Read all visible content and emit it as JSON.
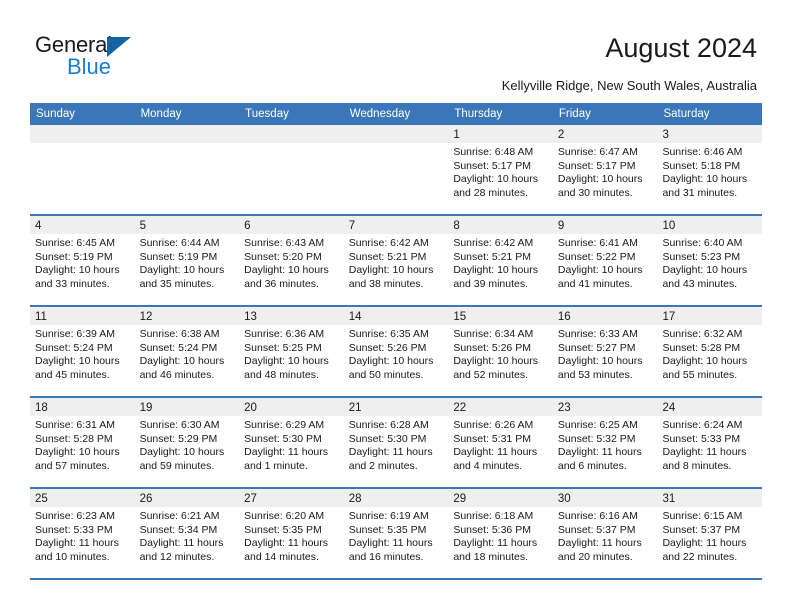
{
  "brand": {
    "word1": "General",
    "word2": "Blue",
    "triangle_color": "#1464a5",
    "blue_color": "#1a7fd4"
  },
  "header": {
    "title": "August 2024",
    "subtitle": "Kellyville Ridge, New South Wales, Australia"
  },
  "theme": {
    "header_blue": "#3a76b8",
    "day_band_gray": "#efefef",
    "text": "#1a1a1a"
  },
  "weekdays": [
    "Sunday",
    "Monday",
    "Tuesday",
    "Wednesday",
    "Thursday",
    "Friday",
    "Saturday"
  ],
  "weeks": [
    [
      {
        "day": "",
        "empty": true,
        "l1": "",
        "l2": "",
        "l3": "",
        "l4": ""
      },
      {
        "day": "",
        "empty": true,
        "l1": "",
        "l2": "",
        "l3": "",
        "l4": ""
      },
      {
        "day": "",
        "empty": true,
        "l1": "",
        "l2": "",
        "l3": "",
        "l4": ""
      },
      {
        "day": "",
        "empty": true,
        "l1": "",
        "l2": "",
        "l3": "",
        "l4": ""
      },
      {
        "day": "1",
        "empty": false,
        "l1": "Sunrise: 6:48 AM",
        "l2": "Sunset: 5:17 PM",
        "l3": "Daylight: 10 hours",
        "l4": "and 28 minutes."
      },
      {
        "day": "2",
        "empty": false,
        "l1": "Sunrise: 6:47 AM",
        "l2": "Sunset: 5:17 PM",
        "l3": "Daylight: 10 hours",
        "l4": "and 30 minutes."
      },
      {
        "day": "3",
        "empty": false,
        "l1": "Sunrise: 6:46 AM",
        "l2": "Sunset: 5:18 PM",
        "l3": "Daylight: 10 hours",
        "l4": "and 31 minutes."
      }
    ],
    [
      {
        "day": "4",
        "empty": false,
        "l1": "Sunrise: 6:45 AM",
        "l2": "Sunset: 5:19 PM",
        "l3": "Daylight: 10 hours",
        "l4": "and 33 minutes."
      },
      {
        "day": "5",
        "empty": false,
        "l1": "Sunrise: 6:44 AM",
        "l2": "Sunset: 5:19 PM",
        "l3": "Daylight: 10 hours",
        "l4": "and 35 minutes."
      },
      {
        "day": "6",
        "empty": false,
        "l1": "Sunrise: 6:43 AM",
        "l2": "Sunset: 5:20 PM",
        "l3": "Daylight: 10 hours",
        "l4": "and 36 minutes."
      },
      {
        "day": "7",
        "empty": false,
        "l1": "Sunrise: 6:42 AM",
        "l2": "Sunset: 5:21 PM",
        "l3": "Daylight: 10 hours",
        "l4": "and 38 minutes."
      },
      {
        "day": "8",
        "empty": false,
        "l1": "Sunrise: 6:42 AM",
        "l2": "Sunset: 5:21 PM",
        "l3": "Daylight: 10 hours",
        "l4": "and 39 minutes."
      },
      {
        "day": "9",
        "empty": false,
        "l1": "Sunrise: 6:41 AM",
        "l2": "Sunset: 5:22 PM",
        "l3": "Daylight: 10 hours",
        "l4": "and 41 minutes."
      },
      {
        "day": "10",
        "empty": false,
        "l1": "Sunrise: 6:40 AM",
        "l2": "Sunset: 5:23 PM",
        "l3": "Daylight: 10 hours",
        "l4": "and 43 minutes."
      }
    ],
    [
      {
        "day": "11",
        "empty": false,
        "l1": "Sunrise: 6:39 AM",
        "l2": "Sunset: 5:24 PM",
        "l3": "Daylight: 10 hours",
        "l4": "and 45 minutes."
      },
      {
        "day": "12",
        "empty": false,
        "l1": "Sunrise: 6:38 AM",
        "l2": "Sunset: 5:24 PM",
        "l3": "Daylight: 10 hours",
        "l4": "and 46 minutes."
      },
      {
        "day": "13",
        "empty": false,
        "l1": "Sunrise: 6:36 AM",
        "l2": "Sunset: 5:25 PM",
        "l3": "Daylight: 10 hours",
        "l4": "and 48 minutes."
      },
      {
        "day": "14",
        "empty": false,
        "l1": "Sunrise: 6:35 AM",
        "l2": "Sunset: 5:26 PM",
        "l3": "Daylight: 10 hours",
        "l4": "and 50 minutes."
      },
      {
        "day": "15",
        "empty": false,
        "l1": "Sunrise: 6:34 AM",
        "l2": "Sunset: 5:26 PM",
        "l3": "Daylight: 10 hours",
        "l4": "and 52 minutes."
      },
      {
        "day": "16",
        "empty": false,
        "l1": "Sunrise: 6:33 AM",
        "l2": "Sunset: 5:27 PM",
        "l3": "Daylight: 10 hours",
        "l4": "and 53 minutes."
      },
      {
        "day": "17",
        "empty": false,
        "l1": "Sunrise: 6:32 AM",
        "l2": "Sunset: 5:28 PM",
        "l3": "Daylight: 10 hours",
        "l4": "and 55 minutes."
      }
    ],
    [
      {
        "day": "18",
        "empty": false,
        "l1": "Sunrise: 6:31 AM",
        "l2": "Sunset: 5:28 PM",
        "l3": "Daylight: 10 hours",
        "l4": "and 57 minutes."
      },
      {
        "day": "19",
        "empty": false,
        "l1": "Sunrise: 6:30 AM",
        "l2": "Sunset: 5:29 PM",
        "l3": "Daylight: 10 hours",
        "l4": "and 59 minutes."
      },
      {
        "day": "20",
        "empty": false,
        "l1": "Sunrise: 6:29 AM",
        "l2": "Sunset: 5:30 PM",
        "l3": "Daylight: 11 hours",
        "l4": "and 1 minute."
      },
      {
        "day": "21",
        "empty": false,
        "l1": "Sunrise: 6:28 AM",
        "l2": "Sunset: 5:30 PM",
        "l3": "Daylight: 11 hours",
        "l4": "and 2 minutes."
      },
      {
        "day": "22",
        "empty": false,
        "l1": "Sunrise: 6:26 AM",
        "l2": "Sunset: 5:31 PM",
        "l3": "Daylight: 11 hours",
        "l4": "and 4 minutes."
      },
      {
        "day": "23",
        "empty": false,
        "l1": "Sunrise: 6:25 AM",
        "l2": "Sunset: 5:32 PM",
        "l3": "Daylight: 11 hours",
        "l4": "and 6 minutes."
      },
      {
        "day": "24",
        "empty": false,
        "l1": "Sunrise: 6:24 AM",
        "l2": "Sunset: 5:33 PM",
        "l3": "Daylight: 11 hours",
        "l4": "and 8 minutes."
      }
    ],
    [
      {
        "day": "25",
        "empty": false,
        "l1": "Sunrise: 6:23 AM",
        "l2": "Sunset: 5:33 PM",
        "l3": "Daylight: 11 hours",
        "l4": "and 10 minutes."
      },
      {
        "day": "26",
        "empty": false,
        "l1": "Sunrise: 6:21 AM",
        "l2": "Sunset: 5:34 PM",
        "l3": "Daylight: 11 hours",
        "l4": "and 12 minutes."
      },
      {
        "day": "27",
        "empty": false,
        "l1": "Sunrise: 6:20 AM",
        "l2": "Sunset: 5:35 PM",
        "l3": "Daylight: 11 hours",
        "l4": "and 14 minutes."
      },
      {
        "day": "28",
        "empty": false,
        "l1": "Sunrise: 6:19 AM",
        "l2": "Sunset: 5:35 PM",
        "l3": "Daylight: 11 hours",
        "l4": "and 16 minutes."
      },
      {
        "day": "29",
        "empty": false,
        "l1": "Sunrise: 6:18 AM",
        "l2": "Sunset: 5:36 PM",
        "l3": "Daylight: 11 hours",
        "l4": "and 18 minutes."
      },
      {
        "day": "30",
        "empty": false,
        "l1": "Sunrise: 6:16 AM",
        "l2": "Sunset: 5:37 PM",
        "l3": "Daylight: 11 hours",
        "l4": "and 20 minutes."
      },
      {
        "day": "31",
        "empty": false,
        "l1": "Sunrise: 6:15 AM",
        "l2": "Sunset: 5:37 PM",
        "l3": "Daylight: 11 hours",
        "l4": "and 22 minutes."
      }
    ]
  ]
}
